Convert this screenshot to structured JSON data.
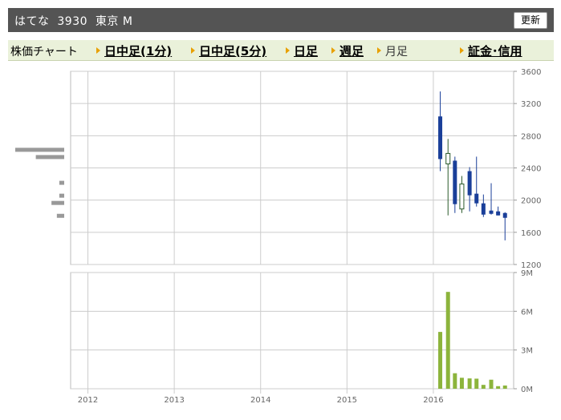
{
  "header": {
    "title": "はてな  3930  東京 M",
    "refresh_label": "更新"
  },
  "tabs": {
    "label": "株価チャート",
    "links": [
      "日中足(1分)",
      "日中足(5分)",
      "日足",
      "週足"
    ],
    "current": "月足",
    "extra": "証金･信用"
  },
  "colors": {
    "header_bg": "#545454",
    "tab_bg": "#eaf1da",
    "arrow": "#e8a000",
    "candle_down": "#1a3f99",
    "candle_up_fill": "#ffffff",
    "candle_up_border": "#2a5a2a",
    "volume": "#8cb43c",
    "volume_profile": "#999999",
    "grid": "#cccccc"
  },
  "chart_data": [
    {
      "type": "candlestick",
      "y_ticks": [
        "3600",
        "3200",
        "2800",
        "2400",
        "2000",
        "1600",
        "1200"
      ],
      "ylim": [
        1200,
        3600
      ],
      "candles": [
        {
          "t": 2016.08,
          "open": 3040,
          "high": 3350,
          "low": 2360,
          "close": 2510
        },
        {
          "t": 2016.17,
          "open": 2450,
          "high": 2760,
          "low": 1810,
          "close": 2580
        },
        {
          "t": 2016.25,
          "open": 2490,
          "high": 2540,
          "low": 1840,
          "close": 1950
        },
        {
          "t": 2016.33,
          "open": 1890,
          "high": 2300,
          "low": 1840,
          "close": 2200
        },
        {
          "t": 2016.42,
          "open": 2360,
          "high": 2410,
          "low": 1860,
          "close": 2060
        },
        {
          "t": 2016.5,
          "open": 2080,
          "high": 2540,
          "low": 1920,
          "close": 1960
        },
        {
          "t": 2016.58,
          "open": 1960,
          "high": 2070,
          "low": 1790,
          "close": 1820
        },
        {
          "t": 2016.67,
          "open": 1870,
          "high": 2210,
          "low": 1820,
          "close": 1830
        },
        {
          "t": 2016.75,
          "open": 1860,
          "high": 1920,
          "low": 1810,
          "close": 1810
        },
        {
          "t": 2016.83,
          "open": 1840,
          "high": 1850,
          "low": 1500,
          "close": 1780
        }
      ],
      "volume_profile": [
        {
          "price": 2620,
          "weight": 1.0
        },
        {
          "price": 2530,
          "weight": 0.58
        },
        {
          "price": 2210,
          "weight": 0.1
        },
        {
          "price": 2050,
          "weight": 0.1
        },
        {
          "price": 1960,
          "weight": 0.26
        },
        {
          "price": 1800,
          "weight": 0.15
        }
      ]
    },
    {
      "type": "bar",
      "y_ticks": [
        "9M",
        "6M",
        "3M",
        "0M"
      ],
      "ylim": [
        0,
        9000000
      ],
      "x_ticks": [
        "2012",
        "2013",
        "2014",
        "2015",
        "2016"
      ],
      "bars": [
        {
          "t": 2016.08,
          "value": 4400000
        },
        {
          "t": 2016.17,
          "value": 7500000
        },
        {
          "t": 2016.25,
          "value": 1200000
        },
        {
          "t": 2016.33,
          "value": 850000
        },
        {
          "t": 2016.42,
          "value": 800000
        },
        {
          "t": 2016.5,
          "value": 780000
        },
        {
          "t": 2016.58,
          "value": 300000
        },
        {
          "t": 2016.67,
          "value": 700000
        },
        {
          "t": 2016.75,
          "value": 200000
        },
        {
          "t": 2016.83,
          "value": 250000
        }
      ]
    }
  ]
}
